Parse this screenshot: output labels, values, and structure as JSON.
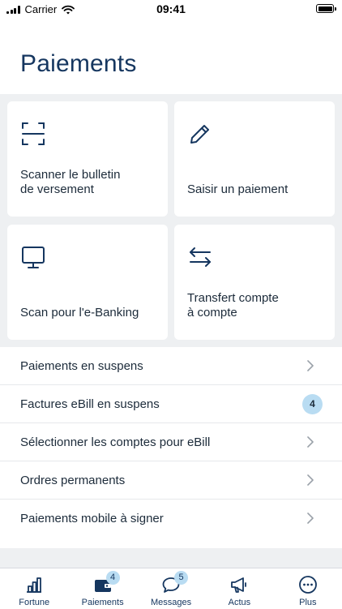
{
  "status": {
    "carrier": "Carrier",
    "time": "09:41"
  },
  "page": {
    "title": "Paiements"
  },
  "cards": [
    {
      "label": "Scanner le bulletin\nde versement",
      "icon": "scan-icon"
    },
    {
      "label": "Saisir un paiement",
      "icon": "pencil-icon"
    },
    {
      "label": "Scan pour l'e-Banking",
      "icon": "monitor-icon"
    },
    {
      "label": "Transfert compte\nà compte",
      "icon": "transfer-arrows-icon"
    }
  ],
  "list": [
    {
      "label": "Paiements en suspens"
    },
    {
      "label": "Factures eBill en suspens",
      "badge": "4"
    },
    {
      "label": "Sélectionner les comptes pour eBill"
    },
    {
      "label": "Ordres permanents"
    },
    {
      "label": "Paiements mobile à signer"
    }
  ],
  "tabs": [
    {
      "label": "Fortune",
      "icon": "bar-chart-icon"
    },
    {
      "label": "Paiements",
      "icon": "wallet-icon",
      "badge": "4",
      "active": true
    },
    {
      "label": "Messages",
      "icon": "chat-bubble-icon",
      "badge": "5"
    },
    {
      "label": "Actus",
      "icon": "megaphone-icon"
    },
    {
      "label": "Plus",
      "icon": "more-dots-icon"
    }
  ],
  "colors": {
    "primary": "#15365f",
    "badge": "#b9dcf2",
    "background": "#eef0f2"
  }
}
